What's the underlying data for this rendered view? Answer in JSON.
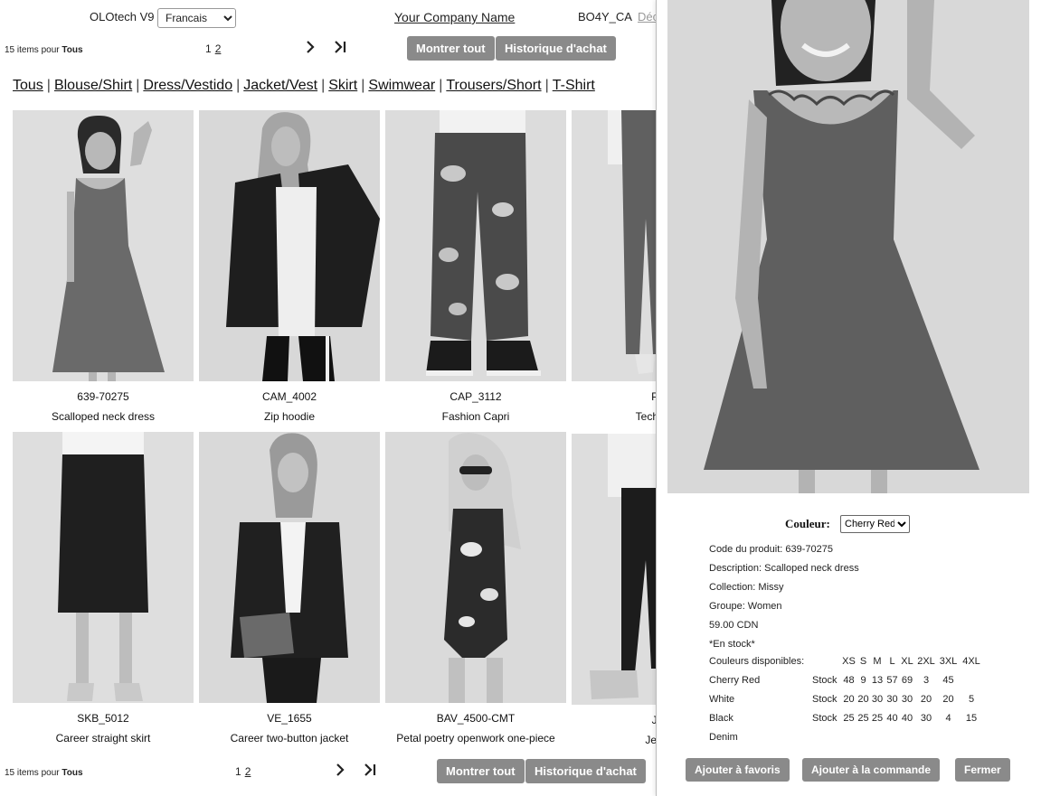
{
  "header": {
    "app_title": "OLOtech V9",
    "language": "Francais",
    "company_link": "Your Company Name",
    "user_code": "BO4Y_CA",
    "logout_link": "Déc"
  },
  "toolbar": {
    "count_number": "15",
    "count_text": "items pour",
    "count_filter": "Tous",
    "current_page": "1",
    "other_page": "2",
    "show_all": "Montrer tout",
    "purchase_history": "Historique d'achat"
  },
  "categories": [
    "Tous",
    "Blouse/Shirt",
    "Dress/Vestido",
    "Jacket/Vest",
    "Skirt",
    "Swimwear",
    "Trousers/Short",
    "T-Shirt"
  ],
  "products": [
    {
      "code": "639-70275",
      "desc": "Scalloped neck dress"
    },
    {
      "code": "CAM_4002",
      "desc": "Zip hoodie"
    },
    {
      "code": "CAP_3112",
      "desc": "Fashion Capri"
    },
    {
      "code": "PAC",
      "desc": "Techno cre"
    },
    {
      "code": "SKB_5012",
      "desc": "Career straight skirt"
    },
    {
      "code": "VE_1655",
      "desc": "Career two-button jacket"
    },
    {
      "code": "BAV_4500-CMT",
      "desc": "Petal poetry openwork one-piece"
    },
    {
      "code": "JEH",
      "desc": "Jean S"
    }
  ],
  "detail": {
    "color_label": "Couleur:",
    "color_selected": "Cherry Red",
    "product_code": "Code du produit: 639-70275",
    "description": "Description: Scalloped neck dress",
    "collection": "Collection: Missy",
    "group": "Groupe: Women",
    "price": "59.00 CDN",
    "in_stock": "*En stock*",
    "colors_label": "Couleurs disponibles:",
    "sizes": [
      "XS",
      "S",
      "M",
      "L",
      "XL",
      "2XL",
      "3XL",
      "4XL"
    ],
    "stock_label": "Stock",
    "stock_rows": [
      {
        "color": "Cherry Red",
        "values": [
          "48",
          "9",
          "13",
          "57",
          "69",
          "3",
          "45",
          ""
        ]
      },
      {
        "color": "White",
        "values": [
          "20",
          "20",
          "30",
          "30",
          "30",
          "20",
          "20",
          "5"
        ]
      },
      {
        "color": "Black",
        "values": [
          "25",
          "25",
          "25",
          "40",
          "40",
          "30",
          "4",
          "15"
        ]
      },
      {
        "color": "Denim",
        "values": []
      }
    ],
    "add_favorites": "Ajouter à favoris",
    "add_order": "Ajouter à la commande",
    "close": "Fermer"
  },
  "colors": {
    "button_bg": "#8a8a8a",
    "button_text": "#ffffff",
    "photo_bg": "#dcdcdc"
  }
}
